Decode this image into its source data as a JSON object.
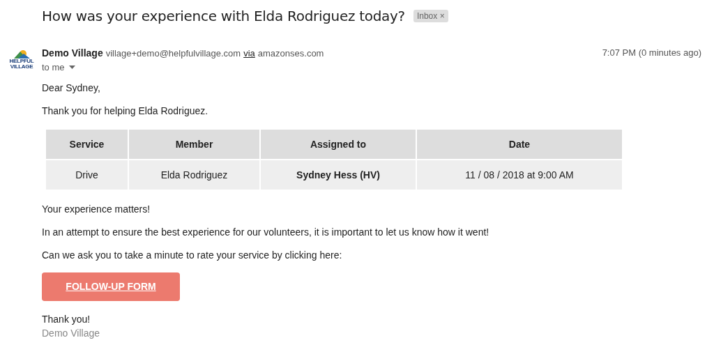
{
  "subject": "How was your experience with Elda Rodriguez today?",
  "label": {
    "text": "Inbox",
    "remove": "×"
  },
  "sender": {
    "logo_text": [
      "HELPFUL",
      "VILLAGE"
    ],
    "name": "Demo Village",
    "email": "village+demo@helpfulvillage.com",
    "via": "via",
    "domain": "amazonses.com",
    "recipient": "to me",
    "time": "7:07 PM (0 minutes ago)"
  },
  "body": {
    "greeting": "Dear Sydney,",
    "intro": "Thank you for helping Elda Rodriguez.",
    "table": {
      "columns": [
        "Service",
        "Member",
        "Assigned to",
        "Date"
      ],
      "rows": [
        {
          "cells": [
            "Drive",
            "Elda Rodriguez",
            "Sydney Hess (HV)",
            "11 / 08 / 2018 at 9:00 AM"
          ]
        }
      ]
    },
    "paragraphs": [
      "Your experience matters!",
      "In an attempt to ensure the best experience for our volunteers, it is important to let us know how it went!",
      "Can we ask you to take a minute to rate your service by clicking here:"
    ],
    "button": "FOLLOW-UP FORM",
    "closing": "Thank you!",
    "signature": "Demo Village"
  }
}
